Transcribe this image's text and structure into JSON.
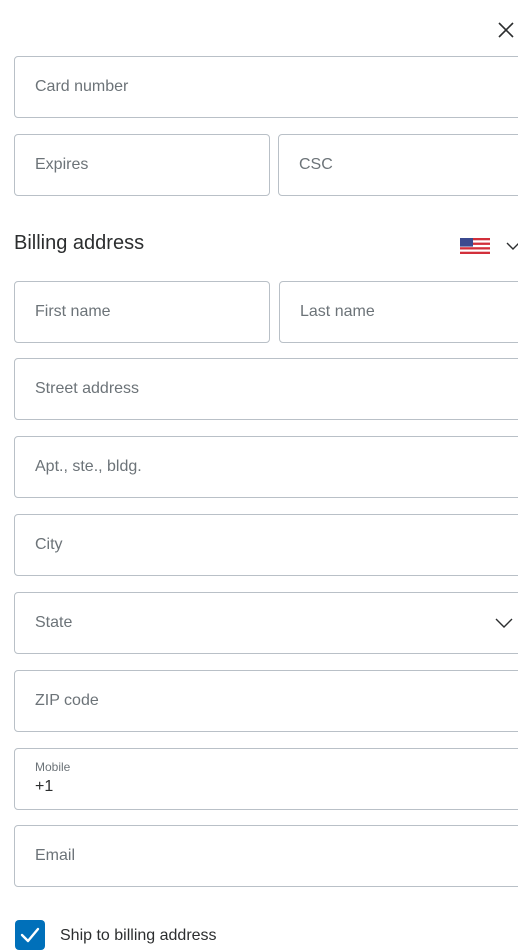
{
  "close": {
    "icon": "close-icon"
  },
  "card": {
    "number_placeholder": "Card number",
    "expires_placeholder": "Expires",
    "csc_placeholder": "CSC"
  },
  "billing": {
    "title": "Billing address",
    "country_icon": "us-flag-icon",
    "first_name_placeholder": "First name",
    "last_name_placeholder": "Last name",
    "street_placeholder": "Street address",
    "apt_placeholder": "Apt., ste., bldg.",
    "city_placeholder": "City",
    "state_placeholder": "State",
    "zip_placeholder": "ZIP code",
    "mobile_label": "Mobile",
    "mobile_value": "+1",
    "email_placeholder": "Email"
  },
  "shipping": {
    "checkbox_checked": true,
    "label": "Ship to billing address"
  },
  "colors": {
    "accent": "#0070ba",
    "border": "#b9c0c7",
    "text": "#2c2e2f",
    "placeholder": "#6c7378"
  }
}
